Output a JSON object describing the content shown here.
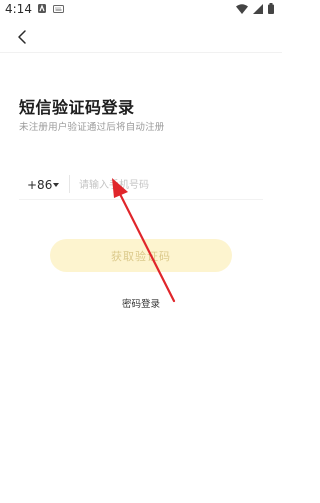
{
  "status_bar": {
    "time": "4:14"
  },
  "header": {
    "back_icon": "chevron-left-icon"
  },
  "title": {
    "main": "短信验证码登录",
    "subtitle": "未注册用户验证通过后将自动注册"
  },
  "phone": {
    "country_code": "+86",
    "placeholder": "请输入手机号码",
    "value": ""
  },
  "actions": {
    "get_code_label": "获取验证码",
    "password_login_label": "密码登录"
  },
  "colors": {
    "button_bg": "#fdf4cf",
    "button_text": "#dbc98a",
    "annotation_arrow": "#e0262b"
  }
}
